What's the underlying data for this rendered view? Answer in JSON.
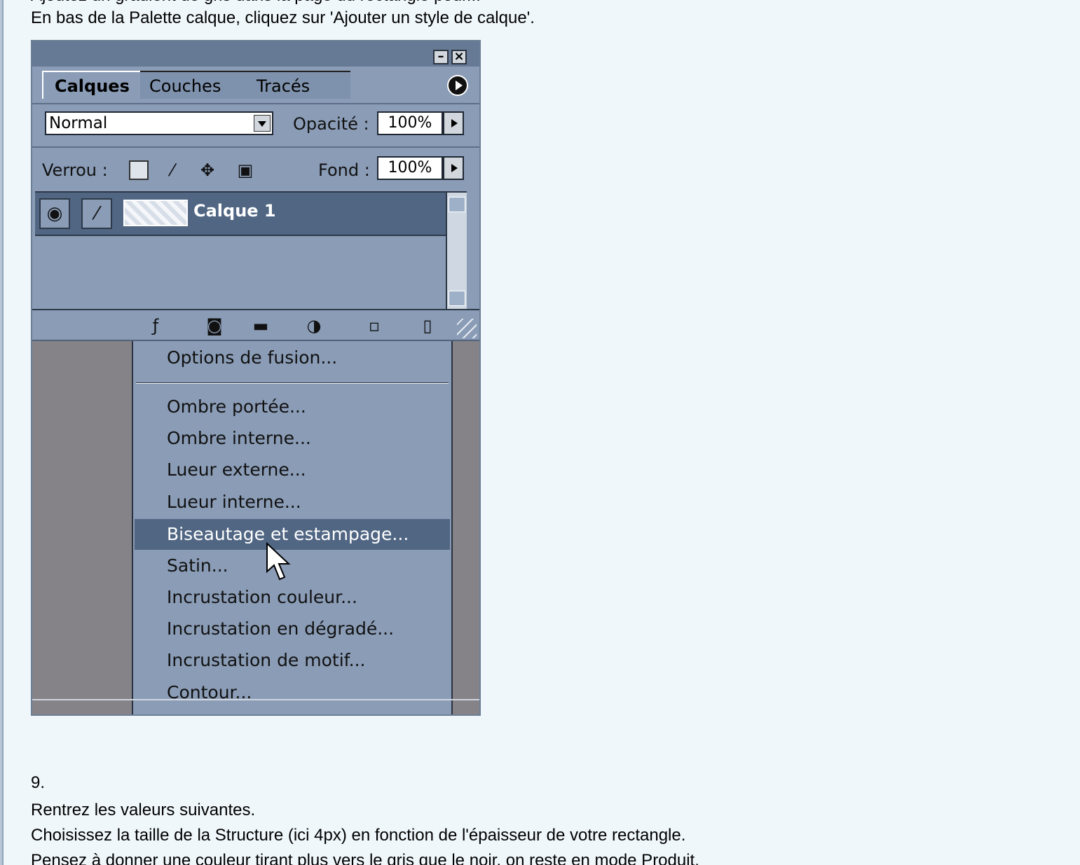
{
  "page": {
    "cut_line": "Ajoutez un gradient de gris dans la page du rectangle pour...",
    "intro": "En bas de la Palette calque, cliquez sur 'Ajouter un style de calque'.",
    "step_number": "9.",
    "step_lines": [
      "Rentrez les valeurs suivantes.",
      "Choisissez la taille de la Structure (ici 4px) en fonction de l'épaisseur de votre rectangle.",
      "Pensez à donner une couleur tirant plus vers le gris que le noir, on reste en mode Produit."
    ]
  },
  "palette": {
    "tabs": [
      "Calques",
      "Couches",
      "Tracés"
    ],
    "blend_mode": "Normal",
    "opacity_label": "Opacité :",
    "opacity_value": "100%",
    "lock_label": "Verrou :",
    "fill_label": "Fond :",
    "fill_value": "100%",
    "layer_name": "Calque 1",
    "icons": [
      "eye-icon",
      "brush-icon",
      "fx-icon",
      "mask-icon",
      "folder-icon",
      "adjustment-icon",
      "new-layer-icon",
      "trash-icon"
    ],
    "colors": {
      "panel": "#8a9cb6",
      "titlebar": "#667a95",
      "highlight": "#506683"
    }
  },
  "menu": {
    "items": [
      "Options de fusion...",
      "Ombre portée...",
      "Ombre interne...",
      "Lueur externe...",
      "Lueur interne...",
      "Biseautage et estampage...",
      "Satin...",
      "Incrustation couleur...",
      "Incrustation en dégradé...",
      "Incrustation de motif...",
      "Contour..."
    ],
    "active_item": "Biseautage et estampage..."
  }
}
